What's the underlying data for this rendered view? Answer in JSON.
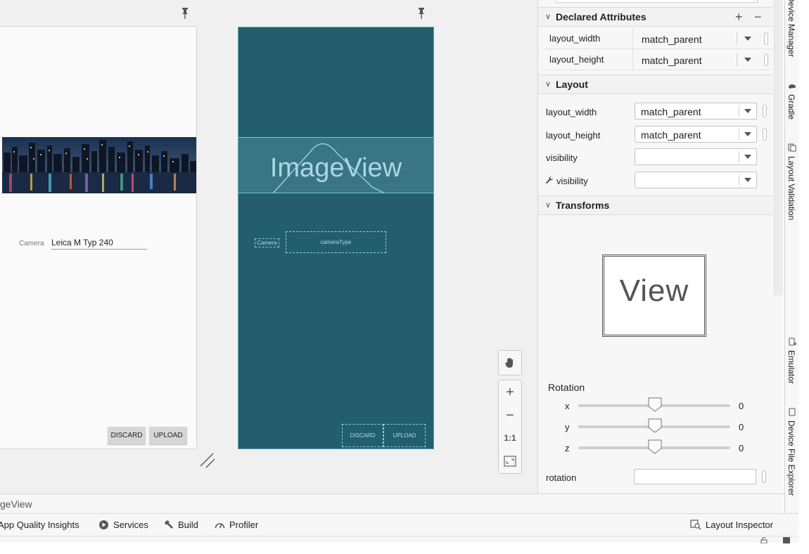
{
  "design": {
    "camera_label": "Camera",
    "camera_value": "Leica M Typ 240",
    "discard_label": "DISCARD",
    "upload_label": "UPLOAD"
  },
  "blueprint": {
    "imageview_label": "ImageView",
    "camera_label": "Camera",
    "cameratype_label": "cameraType",
    "discard_label": "DISCARD",
    "upload_label": "UPLOAD"
  },
  "zoom": {
    "pan_icon": "hand-icon",
    "zoom_in": "+",
    "zoom_out": "−",
    "actual_size": "1:1",
    "fit_icon": "fit-screen-icon"
  },
  "attributes": {
    "declared": {
      "title": "Declared Attributes",
      "rows": [
        {
          "name": "layout_width",
          "value": "match_parent"
        },
        {
          "name": "layout_height",
          "value": "match_parent"
        }
      ]
    },
    "layout": {
      "title": "Layout",
      "rows": [
        {
          "name": "layout_width",
          "value": "match_parent"
        },
        {
          "name": "layout_height",
          "value": "match_parent"
        },
        {
          "name": "visibility",
          "value": ""
        },
        {
          "name": "visibility",
          "value": ""
        }
      ]
    },
    "transforms": {
      "title": "Transforms",
      "preview_label": "View",
      "rotation_title": "Rotation",
      "sliders": [
        {
          "axis": "x",
          "value": "0"
        },
        {
          "axis": "y",
          "value": "0"
        },
        {
          "axis": "z",
          "value": "0"
        }
      ],
      "rotation_field": "rotation"
    }
  },
  "toolstrip": {
    "tabs": [
      "Device Manager",
      "Gradle",
      "Layout Validation",
      "Emulator",
      "Device File Explorer"
    ]
  },
  "breadcrumb": "geView",
  "bottom_bar": {
    "items": [
      "App Quality Insights",
      "Services",
      "Build",
      "Profiler"
    ],
    "right_item": "Layout Inspector"
  },
  "colors": {
    "blueprint_bg": "#245e6e",
    "blueprint_line": "#8ed0de"
  }
}
